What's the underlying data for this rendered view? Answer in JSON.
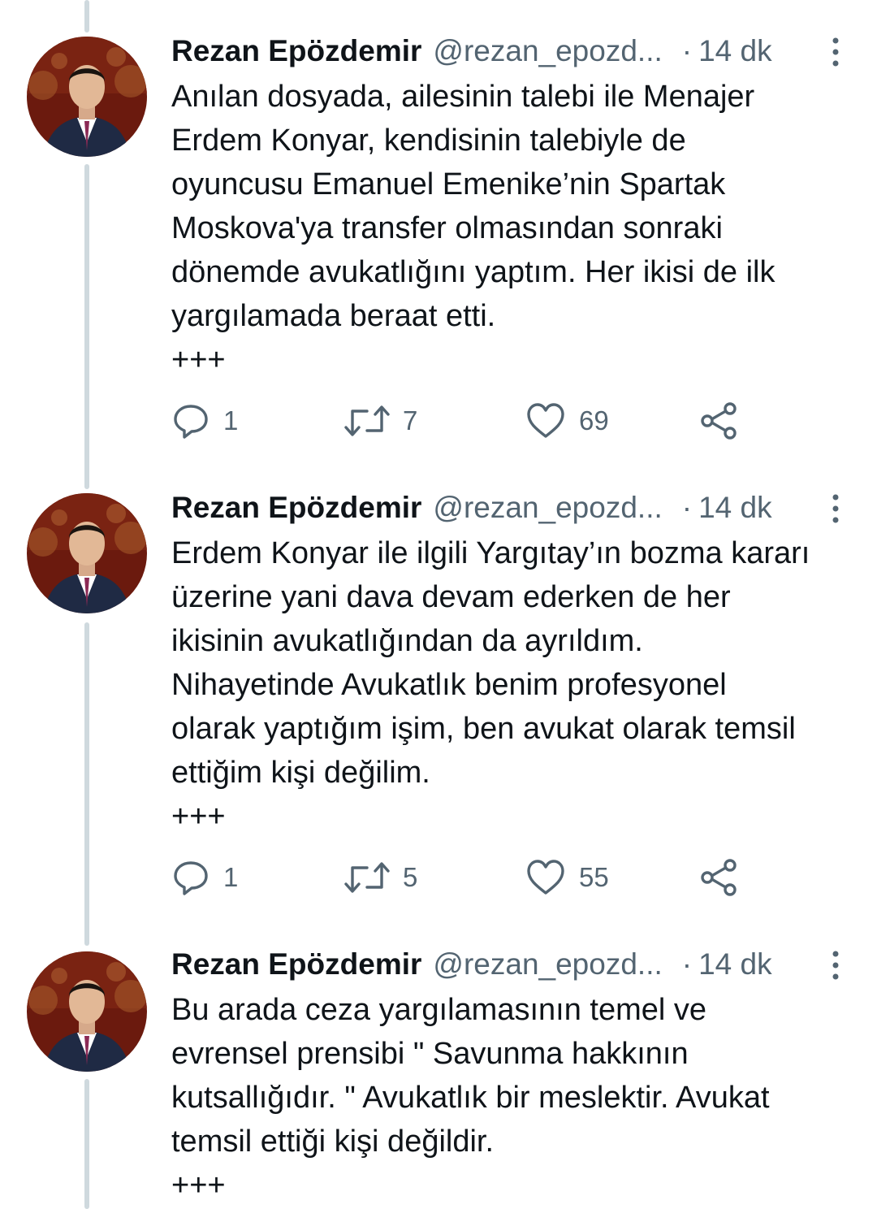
{
  "tweets": [
    {
      "author": "Rezan Epözdemir",
      "handle": "@rezan_epozd...",
      "separator": "·",
      "time": "14 dk",
      "lines": [
        "Anılan dosyada, ailesinin talebi ile Menajer",
        "Erdem Konyar, kendisinin talebiyle de",
        "oyuncusu Emanuel Emenike’nin Spartak",
        "Moskova'ya transfer olmasından sonraki",
        "dönemde avukatlığını yaptım. Her ikisi de ilk",
        "yargılamada beraat etti.",
        "+++"
      ],
      "replies": "1",
      "retweets": "7",
      "likes": "69"
    },
    {
      "author": "Rezan Epözdemir",
      "handle": "@rezan_epozd...",
      "separator": "·",
      "time": "14 dk",
      "lines": [
        "Erdem Konyar ile ilgili Yargıtay’ın bozma kararı",
        "üzerine yani dava devam ederken de her",
        "ikisinin avukatlığından da ayrıldım.",
        "Nihayetinde Avukatlık benim profesyonel",
        "olarak yaptığım işim, ben avukat olarak temsil",
        "ettiğim kişi değilim.",
        "+++"
      ],
      "replies": "1",
      "retweets": "5",
      "likes": "55"
    },
    {
      "author": "Rezan Epözdemir",
      "handle": "@rezan_epozd...",
      "separator": "·",
      "time": "14 dk",
      "lines": [
        "Bu arada ceza yargılamasının temel ve",
        "evrensel prensibi \" Savunma hakkının",
        "kutsallığıdır. \" Avukatlık bir meslektir. Avukat",
        "temsil ettiği kişi değildir.",
        "+++"
      ]
    }
  ],
  "colors": {
    "text": "#0f1419",
    "secondary": "#536471",
    "thread_line": "#cfd9de",
    "background": "#ffffff"
  },
  "icons": [
    "reply-icon",
    "retweet-icon",
    "like-icon",
    "share-icon",
    "more-options-icon"
  ]
}
